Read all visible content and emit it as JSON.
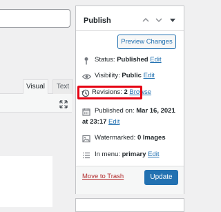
{
  "publish": {
    "title": "Publish",
    "preview_label": "Preview Changes",
    "status_label": "Status:",
    "status_value": "Published",
    "visibility_label": "Visibility:",
    "visibility_value": "Public",
    "revisions_label": "Revisions:",
    "revisions_value": "2",
    "browse_label": "Browse",
    "published_label": "Published on:",
    "published_value_line1": "Mar 16, 2021",
    "published_at": "at 23:17",
    "watermarked_label": "Watermarked:",
    "watermarked_value": "0 Images",
    "menu_label": "In menu:",
    "menu_value": "primary",
    "edit_label": "Edit",
    "trash_label": "Move to Trash",
    "update_label": "Update"
  },
  "editor": {
    "tabs": [
      "Visual",
      "Text"
    ]
  },
  "colors": {
    "accent": "#2271b1",
    "highlight": "#e60012",
    "trash": "#b32d2e"
  }
}
